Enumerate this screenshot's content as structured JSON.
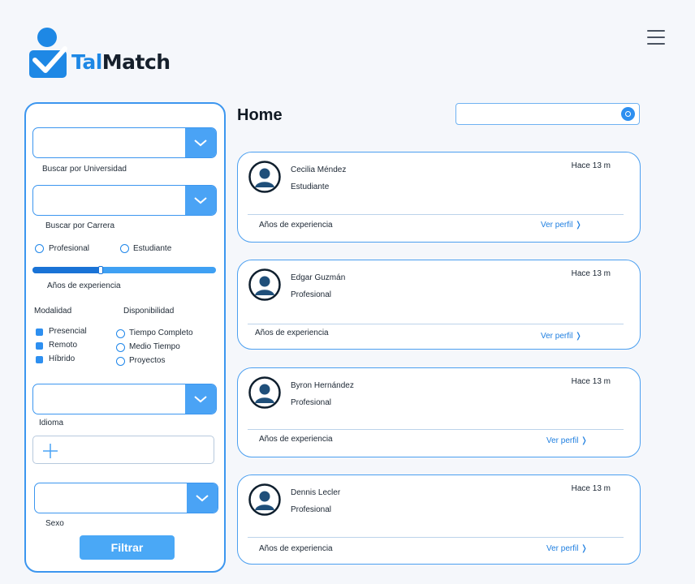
{
  "header": {
    "brand_prefix": "Tal",
    "brand_suffix": "Match",
    "menu_icon": "hamburger-icon"
  },
  "filters": {
    "university_label": "Buscar por Universidad",
    "career_label": "Buscar por Carrera",
    "status_options": [
      "Profesional",
      "Estudiante"
    ],
    "experience_label": "Años de experiencia",
    "experience_level": 0.37,
    "modality_title": "Modalidad",
    "modality_options": [
      "Presencial",
      "Remoto",
      "Híbrido"
    ],
    "availability_title": "Disponibilidad",
    "availability_options": [
      "Tiempo Completo",
      "Medio Tiempo",
      "Proyectos"
    ],
    "language_label": "Idioma",
    "gender_label": "Sexo",
    "filter_button": "Filtrar",
    "accent_color": "#3c96ef"
  },
  "main": {
    "title": "Home",
    "search_placeholder": ""
  },
  "candidates": [
    {
      "name": "Cecilia Méndez",
      "role": "Estudiante",
      "since": "Hace 13 m",
      "experience_label": "Años de experiencia",
      "profile_link": "Ver perfil ❭"
    },
    {
      "name": "Edgar Guzmán",
      "role": "Profesional",
      "since": "Hace 13 m",
      "experience_label": "Años de experiencia",
      "profile_link": "Ver perfil ❭"
    },
    {
      "name": "Byron Hernández",
      "role": "Profesional",
      "since": "Hace 13 m",
      "experience_label": "Años de experiencia",
      "profile_link": "Ver perfil ❭"
    },
    {
      "name": "Dennis Lecler",
      "role": "Profesional",
      "since": "Hace 13 m",
      "experience_label": "Años de experiencia",
      "profile_link": "Ver perfil ❭"
    }
  ]
}
